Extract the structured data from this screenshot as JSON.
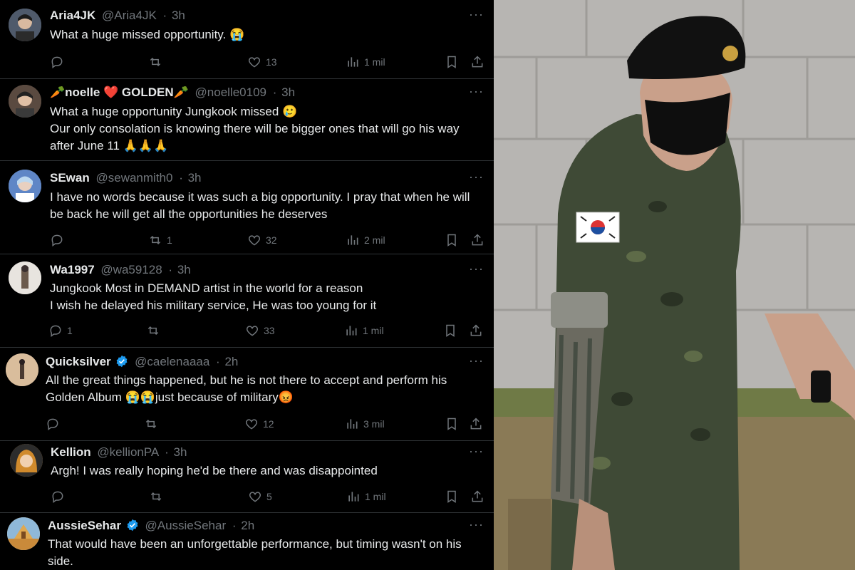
{
  "tweets": [
    {
      "name": "Aria4JK",
      "handle": "@Aria4JK",
      "time": "3h",
      "text": "What a huge missed opportunity. 😭",
      "replies": "",
      "retweets": "",
      "likes": "13",
      "views": "1 mil",
      "verified": false,
      "avatar_color": "#6b7a8f"
    },
    {
      "name": "🥕noelle ❤️ GOLDEN🥕",
      "handle": "@noelle0109",
      "time": "3h",
      "text": "What a huge opportunity Jungkook missed 🥲\nOur only consolation is knowing there will be bigger ones that will go his way after June 11 🙏🙏🙏",
      "replies": "",
      "retweets": "",
      "likes": "",
      "views": "",
      "verified": false,
      "avatar_color": "#7a6a5c"
    },
    {
      "name": "SEwan",
      "handle": "@sewanmith0",
      "time": "3h",
      "text": "I have no words because it was such a big opportunity. I  pray that when he will be back he will get all the opportunities he deserves",
      "replies": "",
      "retweets": "1",
      "likes": "32",
      "views": "2 mil",
      "verified": false,
      "avatar_color": "#8fb0d8"
    },
    {
      "name": "Wa1997",
      "handle": "@wa59128",
      "time": "3h",
      "text": "Jungkook Most in DEMAND artist in the world for a reason\nI wish he delayed his military service, He was too young for it",
      "replies": "1",
      "retweets": "",
      "likes": "33",
      "views": "1 mil",
      "verified": false,
      "avatar_color": "#b9b3ad"
    },
    {
      "name": "Quicksilver",
      "handle": "@caelenaaaa",
      "time": "2h",
      "text": "All the great things happened, but he is not there to accept and perform his Golden Album 😭😭just because of military😡",
      "replies": "",
      "retweets": "",
      "likes": "12",
      "views": "3 mil",
      "verified": true,
      "avatar_color": "#c9a98a"
    },
    {
      "name": "Kellion",
      "handle": "@kellionPA",
      "time": "3h",
      "text": "Argh! I was really hoping he'd be there and was disappointed",
      "replies": "",
      "retweets": "",
      "likes": "5",
      "views": "1 mil",
      "verified": false,
      "avatar_color": "#c98a3a"
    },
    {
      "name": "AussieSehar",
      "handle": "@AussieSehar",
      "time": "2h",
      "text": "That would have been an unforgettable performance, but timing wasn't on his side.",
      "replies": "",
      "retweets": "",
      "likes": "",
      "views": "",
      "verified": true,
      "avatar_color": "#d9a24a"
    }
  ],
  "colors": {
    "accent": "#1d9bf0",
    "muted": "#71767b",
    "text": "#e7e9ea",
    "background": "#000000"
  },
  "photo": {
    "description_icon": "soldier-photo",
    "flag": "korea-flag-patch"
  }
}
